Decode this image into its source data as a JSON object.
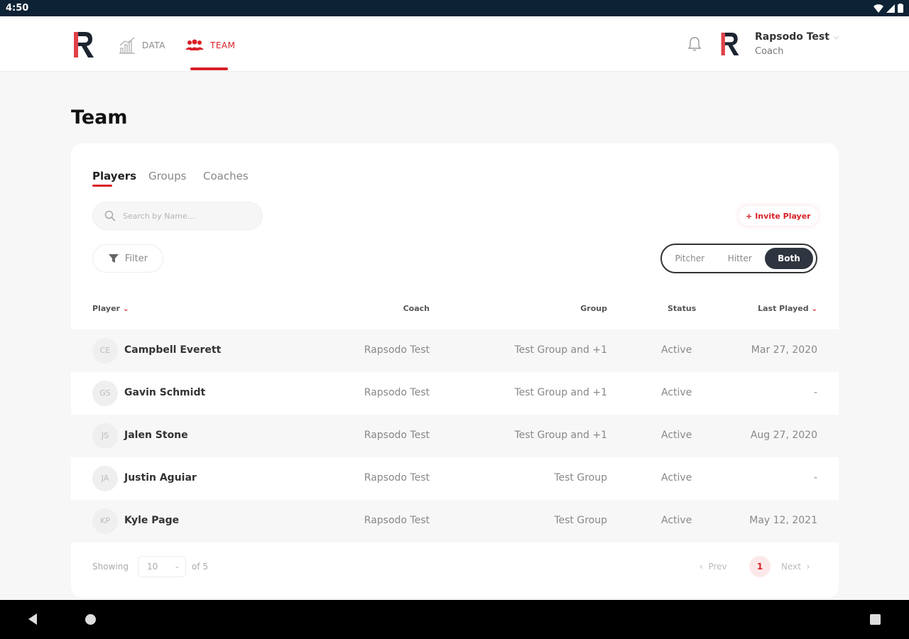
{
  "statusbar": {
    "time": "4:50"
  },
  "nav": {
    "items": [
      {
        "label": "DATA"
      },
      {
        "label": "TEAM"
      }
    ],
    "user": {
      "name": "Rapsodo Test",
      "role": "Coach"
    }
  },
  "page": {
    "title": "Team"
  },
  "tabs": [
    {
      "label": "Players"
    },
    {
      "label": "Groups"
    },
    {
      "label": "Coaches"
    }
  ],
  "search": {
    "placeholder": "Search by Name..."
  },
  "invite": {
    "label": "Invite Player"
  },
  "filter": {
    "label": "Filter"
  },
  "segment": {
    "options": [
      "Pitcher",
      "Hitter",
      "Both"
    ],
    "selected": "Both"
  },
  "table": {
    "headers": {
      "player": "Player",
      "coach": "Coach",
      "group": "Group",
      "status": "Status",
      "last_played": "Last Played"
    },
    "rows": [
      {
        "initials": "CE",
        "name": "Campbell Everett",
        "coach": "Rapsodo Test",
        "group": "Test Group and +1",
        "status": "Active",
        "last_played": "Mar 27, 2020"
      },
      {
        "initials": "GS",
        "name": "Gavin Schmidt",
        "coach": "Rapsodo Test",
        "group": "Test Group and +1",
        "status": "Active",
        "last_played": "-"
      },
      {
        "initials": "JS",
        "name": "Jalen Stone",
        "coach": "Rapsodo Test",
        "group": "Test Group and +1",
        "status": "Active",
        "last_played": "Aug 27, 2020"
      },
      {
        "initials": "JA",
        "name": "Justin Aguiar",
        "coach": "Rapsodo Test",
        "group": "Test Group",
        "status": "Active",
        "last_played": "-"
      },
      {
        "initials": "KP",
        "name": "Kyle Page",
        "coach": "Rapsodo Test",
        "group": "Test Group",
        "status": "Active",
        "last_played": "May 12, 2021"
      }
    ]
  },
  "pagination": {
    "showing_label": "Showing",
    "page_size": "10",
    "of_total": "of 5",
    "prev": "Prev",
    "current_page": "1",
    "next": "Next"
  },
  "colors": {
    "accent": "#d92027",
    "dark": "#2e3540",
    "statusbar": "#0d2234"
  }
}
